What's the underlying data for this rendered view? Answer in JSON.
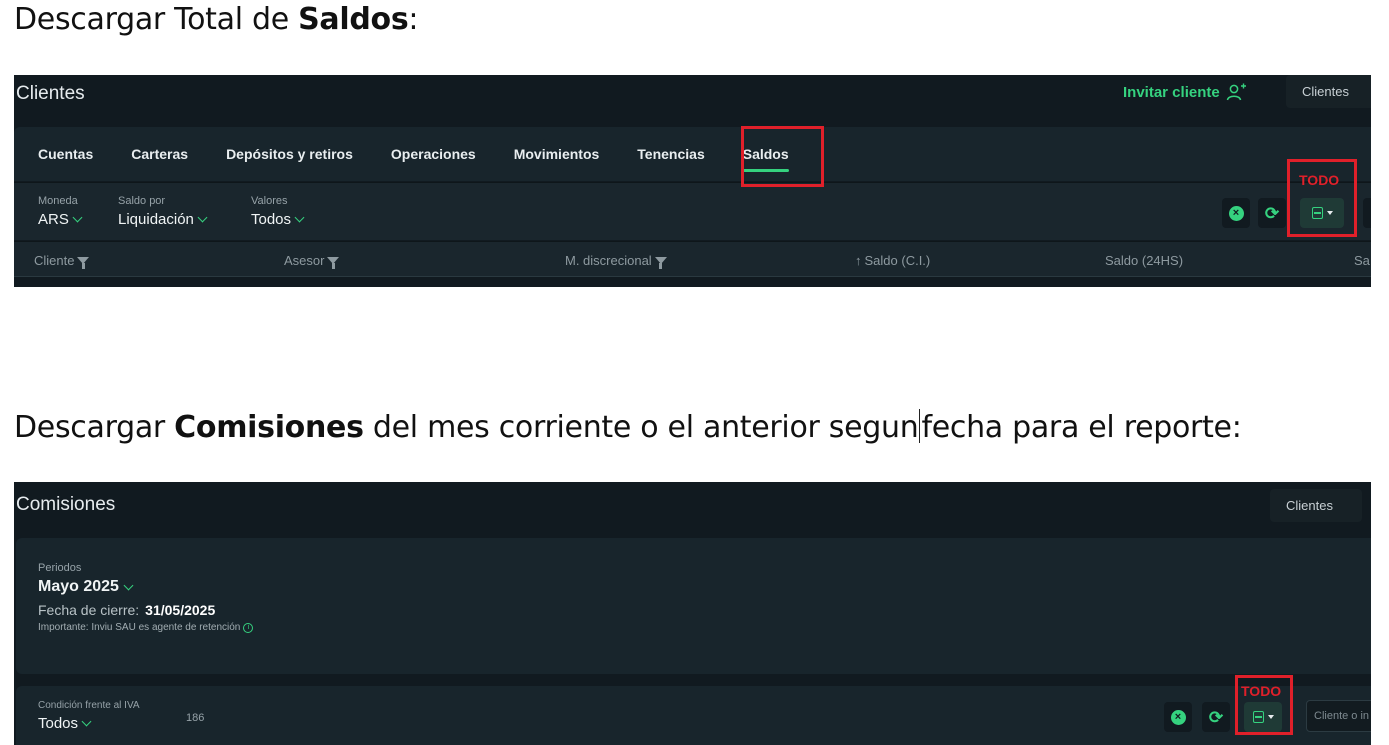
{
  "section1": {
    "heading_pre": "Descargar Total de ",
    "heading_bold": "Saldos",
    "heading_post": ":",
    "screenshot": {
      "app_title": "Clientes",
      "invite_label": "Invitar cliente",
      "top_tab": "Clientes",
      "tabs": [
        "Cuentas",
        "Carteras",
        "Depósitos y retiros",
        "Operaciones",
        "Movimientos",
        "Tenencias",
        "Saldos"
      ],
      "active_tab": "Saldos",
      "filters": {
        "moneda": {
          "label": "Moneda",
          "value": "ARS"
        },
        "saldo_por": {
          "label": "Saldo por",
          "value": "Liquidación"
        },
        "valores": {
          "label": "Valores",
          "value": "Todos"
        }
      },
      "columns": [
        "Cliente",
        "Asesor",
        "M. discrecional",
        "Saldo (C.I.)",
        "Saldo (24HS)",
        "Sa"
      ],
      "sort_arrow": "↑",
      "annotation": "TODO"
    }
  },
  "section2": {
    "heading_pre": "Descargar ",
    "heading_bold": "Comisiones",
    "heading_post_a": " del mes corriente o el anterior segun",
    "heading_post_b": "fecha para el reporte:",
    "screenshot": {
      "app_title": "Comisiones",
      "top_tab": "Clientes",
      "periodos_label": "Periodos",
      "periodo_value": "Mayo 2025",
      "fecha_label": "Fecha de cierre:",
      "fecha_value": "31/05/2025",
      "note": "Importante: Inviu SAU es agente de retención",
      "iva_label": "Condición frente al IVA",
      "iva_value": "Todos",
      "count": "186",
      "search_placeholder": "Cliente o in",
      "annotation": "TODO"
    }
  },
  "colors": {
    "accent": "#35d27f",
    "annotation": "#e0202a",
    "background": "#111a20",
    "panel": "#18252c"
  },
  "icons": [
    "user-plus-icon",
    "chevron-down-icon",
    "clear-filters-icon",
    "refresh-icon",
    "xls-file-icon",
    "caret-down-icon",
    "filter-icon",
    "sort-up-icon",
    "info-icon"
  ]
}
